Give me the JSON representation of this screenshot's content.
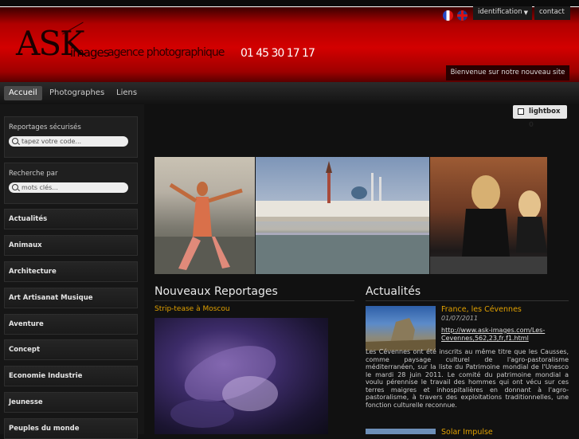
{
  "header": {
    "logo_ask": "ASK",
    "logo_images": "images",
    "logo_tagline": "agence photographique",
    "phone": "01 45 30 17 17",
    "identification_label": "identification",
    "contact_label": "contact",
    "welcome": "Bienvenue sur notre nouveau site"
  },
  "nav": {
    "tabs": [
      "Accueil",
      "Photographes",
      "Liens"
    ]
  },
  "sidebar": {
    "secure_title": "Reportages sécurisés",
    "secure_placeholder": "tapez votre code...",
    "search_title": "Recherche par",
    "search_placeholder": "mots clés...",
    "categories": [
      "Actualités",
      "Animaux",
      "Architecture",
      "Art Artisanat Musique",
      "Aventure",
      "Concept",
      "Economie Industrie",
      "Jeunesse",
      "Peuples du monde"
    ]
  },
  "lightbox": {
    "label": "lightbox 0"
  },
  "reports": {
    "title": "Nouveaux Reportages",
    "first_title": "Strip-tease à Moscou"
  },
  "news": {
    "title": "Actualités",
    "items": [
      {
        "title": "France, les Cévennes",
        "date": "01/07/2011",
        "link": "http://www.ask-images.com/Les-Cevennes,562,23,fr,f1.html",
        "body": "Les Cévennes ont été inscrits au même titre que les Causses, comme paysage culturel de l'agro-pastoralisme méditerranéen, sur la liste du Patrimoine mondial de l'Unesco le mardi 28 juin 2011. Le comité du patrimoine mondial a voulu pérennise le travail des hommes qui ont vécu sur ces terres maigres et inhospitalières en donnant à l'agro-pastoralisme, à travers des exploitations traditionnelles, une fonction culturelle reconnue."
      },
      {
        "title": "Solar Impulse"
      }
    ]
  },
  "colors": {
    "accent": "#e0a000",
    "header_red": "#d30000"
  }
}
